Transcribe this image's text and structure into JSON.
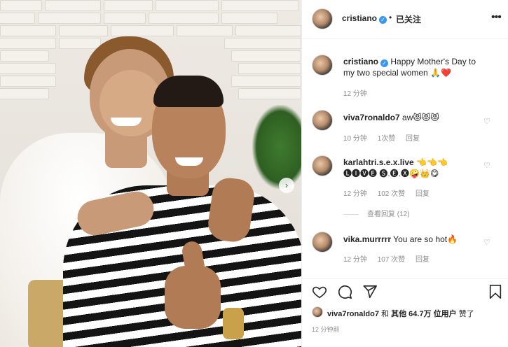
{
  "post": {
    "author": "cristiano",
    "follow_status": "已关注",
    "separator": "•",
    "caption": "Happy Mother's Day to my two special women 🙏❤️",
    "caption_time": "12 分钟",
    "more_icon": "more-horizontal-icon",
    "verified_icon": "verified-badge-icon"
  },
  "comments": [
    {
      "user": "viva7ronaldo7",
      "text": "aw😻😻😻",
      "time": "10 分钟",
      "likes": "1次赞",
      "reply": "回复"
    },
    {
      "user": "karlahtri.s.e.x.live",
      "text": "👈👈👈 🅛🅘🅥🅔 🅢.🅔.🅧🤪👑😋",
      "time": "12 分钟",
      "likes": "102 次赞",
      "reply": "回复"
    },
    {
      "user": "vika.murrrrr",
      "text": "You are so hot🔥",
      "time": "12 分钟",
      "likes": "107 次赞",
      "reply": "回复"
    }
  ],
  "view_replies": "查看回复 (12)",
  "actions": {
    "like_icon": "heart-icon",
    "comment_icon": "comment-icon",
    "share_icon": "share-icon",
    "save_icon": "bookmark-icon"
  },
  "likes": {
    "user": "viva7ronaldo7",
    "middle": "和",
    "others": "其他 64.7万 位用户",
    "suffix": "赞了"
  },
  "posted_ago": "12 分钟前",
  "carousel_next": "›"
}
